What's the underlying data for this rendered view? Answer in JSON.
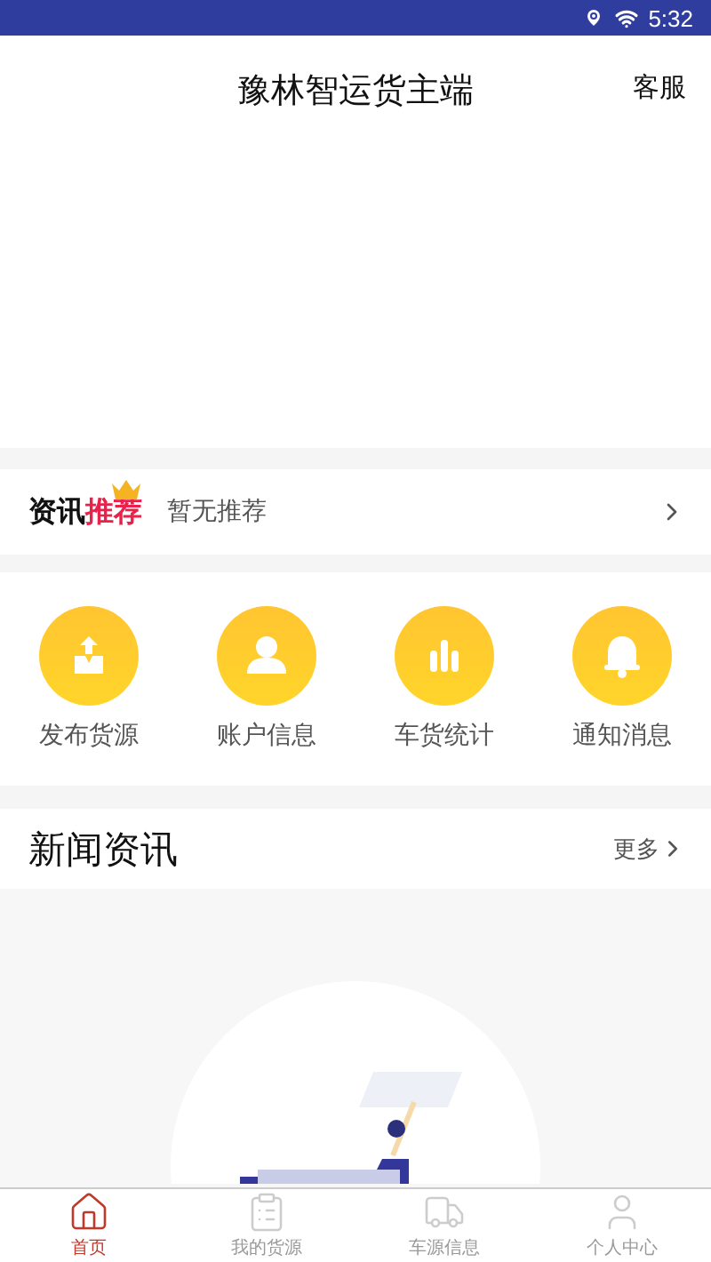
{
  "status_bar": {
    "time": "5:32"
  },
  "header": {
    "title": "豫林智运货主端",
    "action": "客服"
  },
  "recommend": {
    "label": "资讯",
    "label_highlight": "推荐",
    "text": "暂无推荐"
  },
  "quick_actions": [
    {
      "kind": "publish",
      "label": "发布货源"
    },
    {
      "kind": "account",
      "label": "账户信息"
    },
    {
      "kind": "stats",
      "label": "车货统计"
    },
    {
      "kind": "notice",
      "label": "通知消息"
    }
  ],
  "news": {
    "title": "新闻资讯",
    "more": "更多"
  },
  "tabs": [
    {
      "kind": "home",
      "label": "首页",
      "selected": true
    },
    {
      "kind": "cargo",
      "label": "我的货源",
      "selected": false
    },
    {
      "kind": "truck",
      "label": "车源信息",
      "selected": false
    },
    {
      "kind": "user",
      "label": "个人中心",
      "selected": false
    }
  ]
}
